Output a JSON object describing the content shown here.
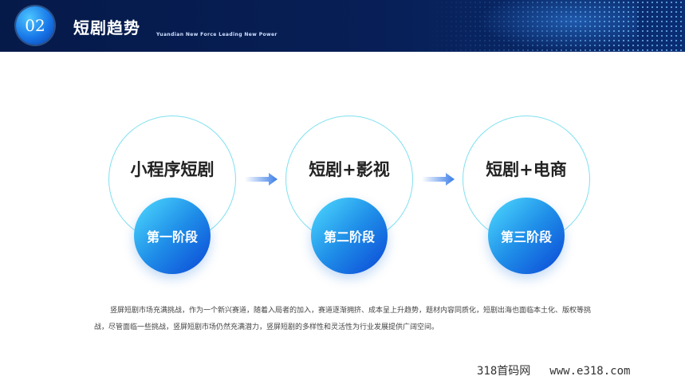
{
  "header": {
    "badge": "02",
    "title": "短剧趋势",
    "subtitle": "Yuandian New Force Leading New Power"
  },
  "stages": [
    {
      "title": "小程序短剧",
      "phase": "第一阶段"
    },
    {
      "title": "短剧+影视",
      "phase": "第二阶段"
    },
    {
      "title": "短剧+电商",
      "phase": "第三阶段"
    }
  ],
  "description": "竖屏短剧市场充满挑战，作为一个新兴赛道，随着入局者的加入，赛道逐渐拥挤、成本呈上升趋势，题材内容同质化，短剧出海也面临本土化、版权等挑战，尽管面临一些挑战，竖屏短剧市场仍然充满潜力，竖屏短剧的多样性和灵活性为行业发展提供广阔空间。",
  "watermark": {
    "left": "318首码网",
    "right": "www.e318.com"
  },
  "colors": {
    "header_bg": "#061a4a",
    "ring": "#7fe0f0",
    "phase_gradient_start": "#4fdcff",
    "phase_gradient_end": "#0b46d6",
    "arrow": "#3a7de8"
  }
}
